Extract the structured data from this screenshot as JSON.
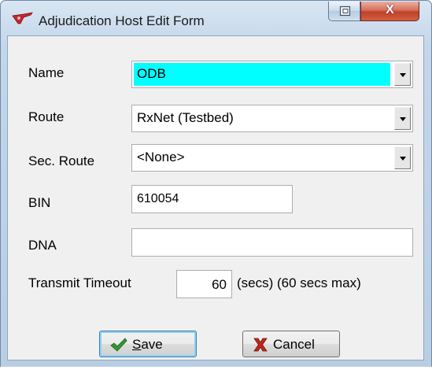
{
  "window": {
    "title": "Adjudication Host Edit Form",
    "restore_icon": "restore-icon",
    "close_label": "X"
  },
  "form": {
    "name_label": "Name",
    "name_value": "ODB",
    "route_label": "Route",
    "route_value": "RxNet (Testbed)",
    "sec_route_label": "Sec. Route",
    "sec_route_value": "<None>",
    "bin_label": "BIN",
    "bin_value": "610054",
    "dna_label": "DNA",
    "dna_value": "",
    "timeout_label": "Transmit Timeout",
    "timeout_value": "60",
    "timeout_suffix": "(secs) (60 secs max)"
  },
  "buttons": {
    "save_prefix": "",
    "save_mnemonic": "S",
    "save_rest": "ave",
    "cancel_label": "Cancel"
  },
  "colors": {
    "highlight": "#00ffff",
    "save_check": "#2e9a2e",
    "cancel_x": "#c0281c"
  }
}
